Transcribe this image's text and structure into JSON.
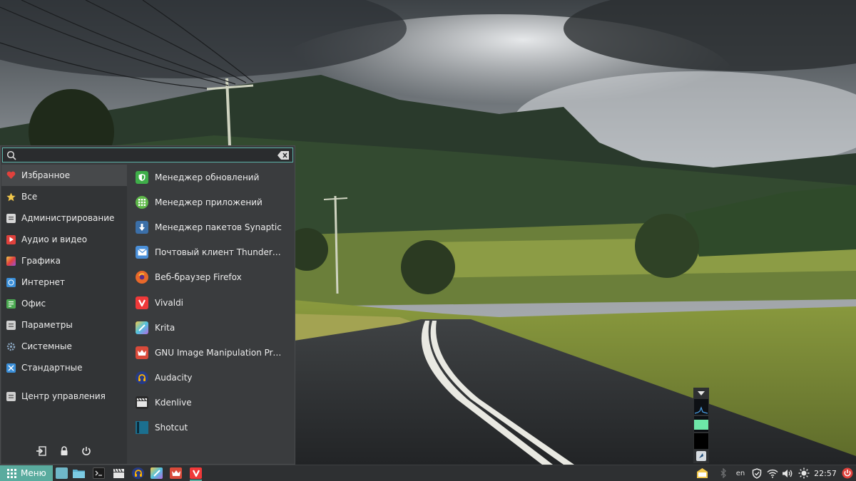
{
  "search": {
    "placeholder": "",
    "value": ""
  },
  "categories": [
    {
      "label": "Избранное",
      "icon": "heart-icon",
      "color": "#e0413c",
      "active": true
    },
    {
      "label": "Все",
      "icon": "star-icon",
      "color": "#f2c84b"
    },
    {
      "label": "Администрирование",
      "icon": "admin-icon",
      "color": "#d7d7d7"
    },
    {
      "label": "Аудио и видео",
      "icon": "play-icon",
      "color": "#e0413c"
    },
    {
      "label": "Графика",
      "icon": "graphics-icon",
      "color": "#c04fd8"
    },
    {
      "label": "Интернет",
      "icon": "internet-icon",
      "color": "#3b8fd8"
    },
    {
      "label": "Офис",
      "icon": "office-icon",
      "color": "#4caa52"
    },
    {
      "label": "Параметры",
      "icon": "settings-icon",
      "color": "#cfcfcf"
    },
    {
      "label": "Системные",
      "icon": "system-gear-icon",
      "color": "#8aa5bf"
    },
    {
      "label": "Стандартные",
      "icon": "accessories-icon",
      "color": "#3b8fd8"
    },
    {
      "label": "Центр управления",
      "icon": "control-center-icon",
      "color": "#cfcfcf"
    }
  ],
  "apps": [
    {
      "label": "Менеджер обновлений",
      "icon": "shield-icon",
      "color": "#3fae49"
    },
    {
      "label": "Менеджер приложений",
      "icon": "app-grid-icon",
      "color": "#5fb94a"
    },
    {
      "label": "Менеджер пакетов Synaptic",
      "icon": "download-icon",
      "color": "#3b6fa8"
    },
    {
      "label": "Почтовый клиент Thunderbird",
      "icon": "mail-icon",
      "color": "#4a8fd8"
    },
    {
      "label": "Веб-браузер Firefox",
      "icon": "firefox-icon",
      "color": "#e8682a"
    },
    {
      "label": "Vivaldi",
      "icon": "vivaldi-icon",
      "color": "#ef3939"
    },
    {
      "label": "Krita",
      "icon": "brush-icon",
      "color": "#b36be0"
    },
    {
      "label": "GNU Image Manipulation Prog…",
      "icon": "gimp-icon",
      "color": "#d94a3a"
    },
    {
      "label": "Audacity",
      "icon": "headphones-icon",
      "color": "#263b85"
    },
    {
      "label": "Kdenlive",
      "icon": "clapper-icon",
      "color": "#3a3a3a"
    },
    {
      "label": "Shotcut",
      "icon": "shotcut-icon",
      "color": "#1b6f8f"
    }
  ],
  "taskbar": {
    "menu_label": "Меню",
    "lang": "en",
    "clock": "22:57"
  },
  "colors": {
    "accent": "#5aab9e"
  }
}
